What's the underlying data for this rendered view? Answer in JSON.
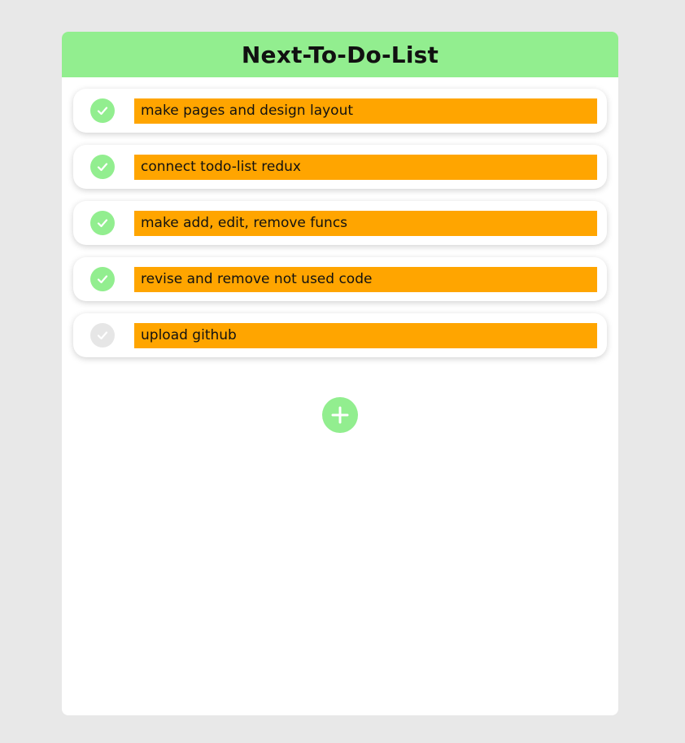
{
  "header": {
    "title": "Next-To-Do-List"
  },
  "colors": {
    "accent_green": "#92ee8f",
    "item_highlight": "#ffa500",
    "unchecked_gray": "#e6e6e6",
    "page_background": "#e8e8e8"
  },
  "todos": [
    {
      "text": "make pages and design layout",
      "done": true,
      "icon": "check-icon"
    },
    {
      "text": "connect todo-list redux",
      "done": true,
      "icon": "check-icon"
    },
    {
      "text": "make add, edit, remove funcs",
      "done": true,
      "icon": "check-icon"
    },
    {
      "text": "revise and remove not used code",
      "done": true,
      "icon": "check-icon"
    },
    {
      "text": "upload github",
      "done": false,
      "icon": "check-icon"
    }
  ],
  "add_button": {
    "icon": "plus-icon"
  }
}
